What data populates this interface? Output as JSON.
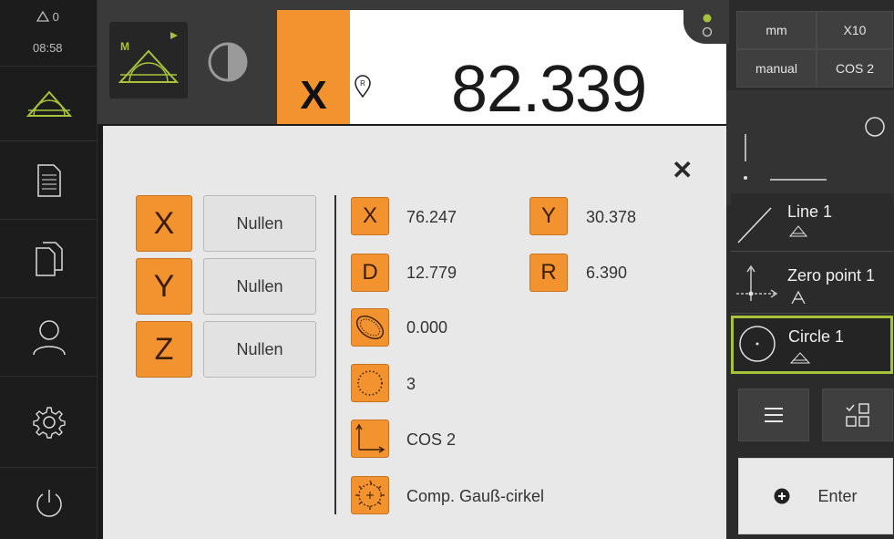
{
  "status": {
    "warnings": "0",
    "time": "08:58"
  },
  "mode_tile": {
    "label": "M"
  },
  "axis": {
    "name": "X",
    "position": "82.339"
  },
  "right_panel": {
    "unit": "mm",
    "zoom": "X10",
    "mode": "manual",
    "cos": "COS 2",
    "features": [
      "Line 1",
      "Zero point 1",
      "Circle 1"
    ],
    "enter_label": "Enter"
  },
  "dialog": {
    "axes": [
      {
        "axis": "X",
        "action": "Nullen"
      },
      {
        "axis": "Y",
        "action": "Nullen"
      },
      {
        "axis": "Z",
        "action": "Nullen"
      }
    ],
    "results": {
      "x_label": "X",
      "x_value": "76.247",
      "y_label": "Y",
      "y_value": "30.378",
      "d_label": "D",
      "d_value": "12.779",
      "r_label": "R",
      "r_value": "6.390",
      "form_error": "0.000",
      "point_count": "3",
      "cos": "COS 2",
      "fit_method": "Comp. Gauß-cirkel"
    }
  },
  "colors": {
    "accent": "#f39330",
    "selection": "#a6c33a",
    "sidebar": "#1c1c1c"
  }
}
